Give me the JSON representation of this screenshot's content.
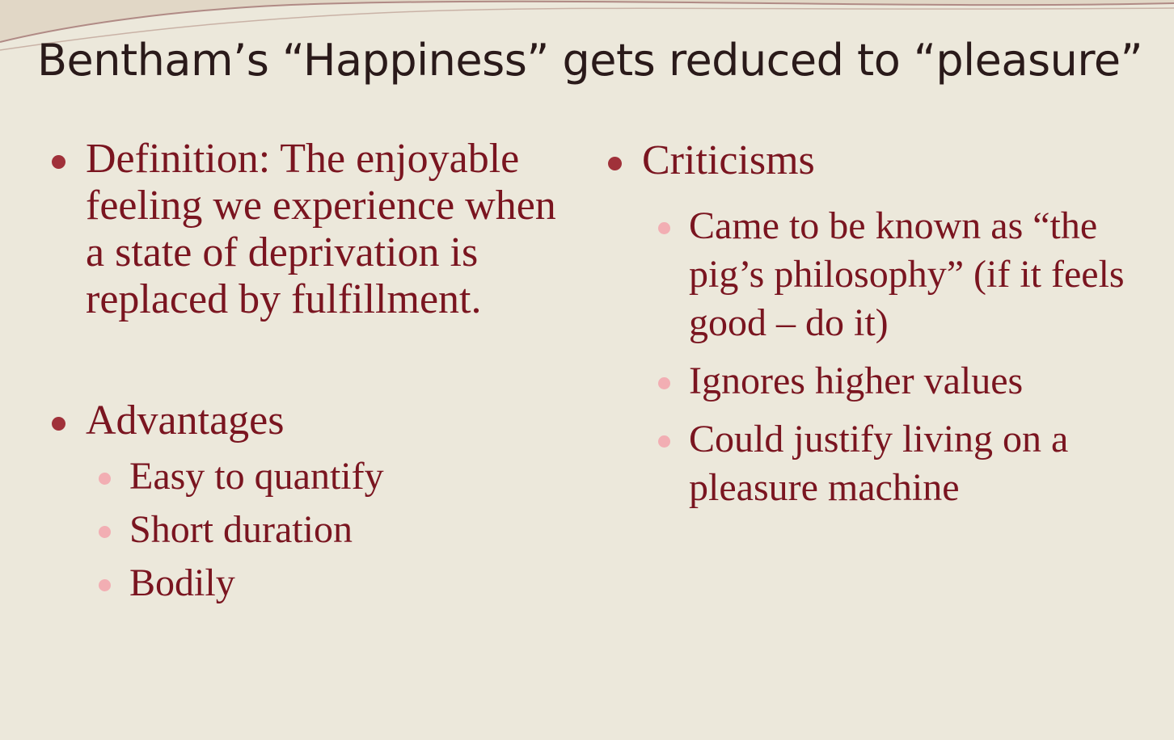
{
  "title": "Bentham’s “Happiness” gets reduced to “pleasure”",
  "left": {
    "definition": "Definition: The enjoyable feeling we experience when a state of deprivation is replaced by fulfillment.",
    "advantages": {
      "heading": "Advantages",
      "items": [
        "Easy to quantify",
        "Short duration",
        "Bodily"
      ]
    }
  },
  "right": {
    "heading": "Criticisms",
    "items": [
      "Came to be known as “the pig’s philosophy” (if it feels good – do it)",
      "Ignores higher values",
      "Could justify living on a pleasure machine"
    ]
  },
  "colors": {
    "background": "#ECE8DB",
    "title_text": "#2A1A1A",
    "body_text": "#7A1520",
    "main_bullet": "#A0313A",
    "sub_bullet": "#F2AEB3"
  }
}
